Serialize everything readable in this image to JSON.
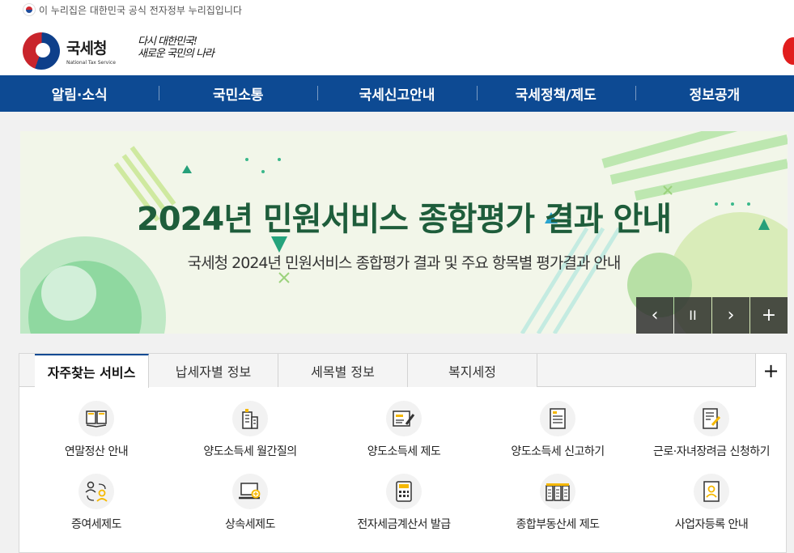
{
  "gov_notice": "이 누리집은 대한민국 공식 전자정부 누리집입니다",
  "logo": {
    "name_ko": "국세청",
    "name_en": "National Tax Service"
  },
  "slogan": {
    "line1": "다시 대한민국!",
    "line2": "새로운 국민의 나라"
  },
  "gnb": [
    "알림·소식",
    "국민소통",
    "국세신고안내",
    "국세정책/제도",
    "정보공개"
  ],
  "banner": {
    "title": "2024년 민원서비스 종합평가 결과 안내",
    "subtitle": "국세청 2024년 민원서비스 종합평가 결과 및 주요 항목별 평가결과 안내",
    "controls": {
      "prev": "‹",
      "pause": "II",
      "next": "›",
      "more": "+"
    }
  },
  "tabs": {
    "items": [
      "자주찾는 서비스",
      "납세자별 정보",
      "세목별 정보",
      "복지세정"
    ],
    "active": 0,
    "more_label": "+"
  },
  "services": [
    {
      "label": "연말정산 안내",
      "icon": "book-icon"
    },
    {
      "label": "양도소득세 월간질의",
      "icon": "building-icon"
    },
    {
      "label": "양도소득세 제도",
      "icon": "document-pen-icon"
    },
    {
      "label": "양도소득세 신고하기",
      "icon": "form-icon"
    },
    {
      "label": "근로·자녀장려금 신청하기",
      "icon": "edit-document-icon"
    },
    {
      "label": "증여세제도",
      "icon": "transfer-people-icon"
    },
    {
      "label": "상속세제도",
      "icon": "computer-icon"
    },
    {
      "label": "전자세금계산서 발급",
      "icon": "calculator-icon"
    },
    {
      "label": "종합부동산세 제도",
      "icon": "buildings-icon"
    },
    {
      "label": "사업자등록 안내",
      "icon": "id-card-icon"
    }
  ],
  "colors": {
    "primary": "#0d4a93",
    "banner_title": "#1e5d3b",
    "accent_yellow": "#f5b800"
  }
}
